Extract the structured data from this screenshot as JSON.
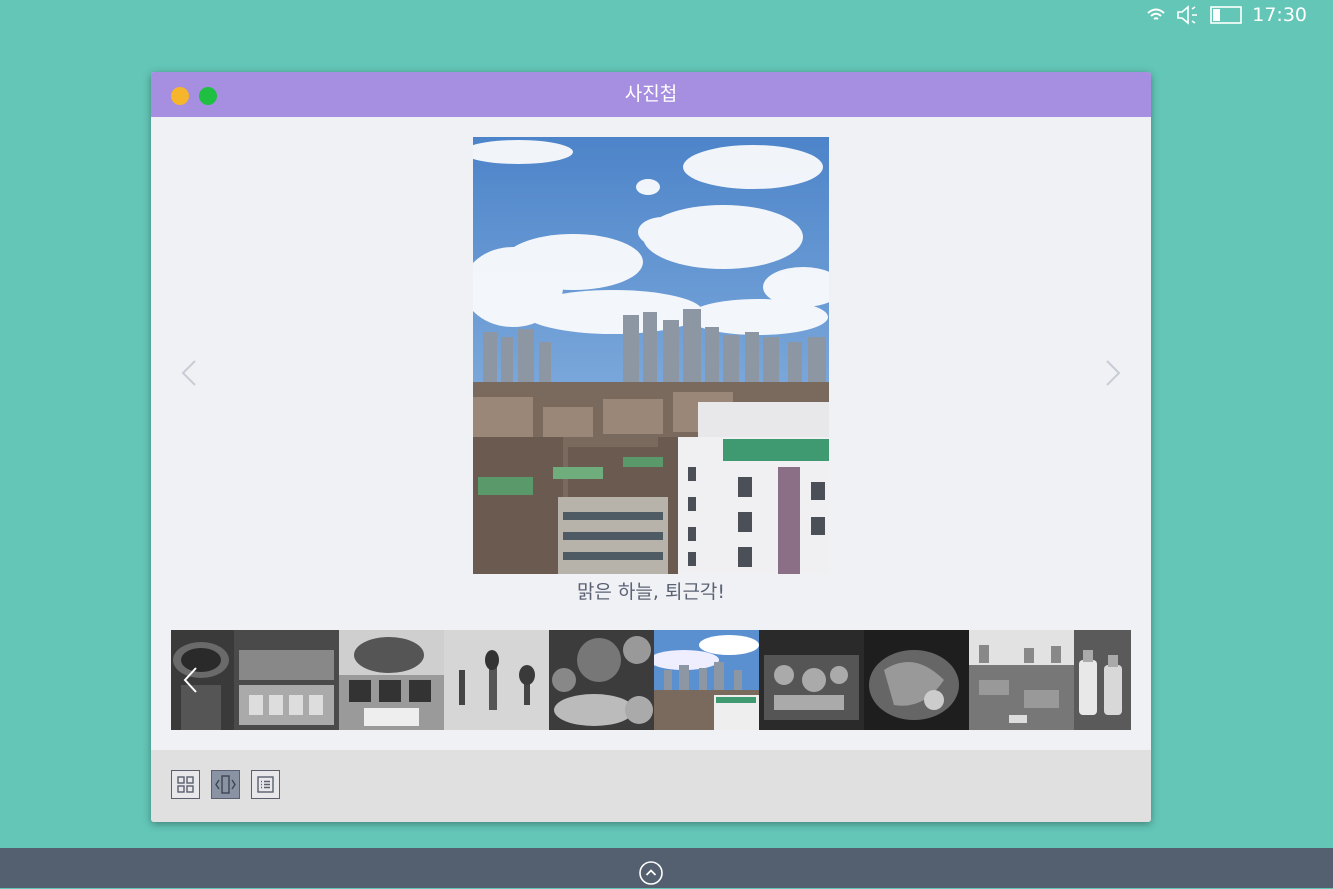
{
  "status": {
    "time": "17:30",
    "wifi_icon": "wifi-icon",
    "volume_icon": "volume-muted-icon",
    "battery_icon": "battery-low-icon"
  },
  "window": {
    "title": "사진첩"
  },
  "viewer": {
    "caption": "맑은 하늘, 퇴근각!",
    "prev_icon": "chevron-left-icon",
    "next_icon": "chevron-right-icon"
  },
  "thumbnails": [
    {
      "subject": "drink",
      "selected": false
    },
    {
      "subject": "sushi-platter",
      "selected": false
    },
    {
      "subject": "bonsai-and-cups",
      "selected": false
    },
    {
      "subject": "plants-on-wall",
      "selected": false
    },
    {
      "subject": "dishes-table",
      "selected": false
    },
    {
      "subject": "city-skyline",
      "selected": true
    },
    {
      "subject": "seafood-platter",
      "selected": false
    },
    {
      "subject": "lobster-dish",
      "selected": false
    },
    {
      "subject": "city-view",
      "selected": false
    },
    {
      "subject": "bottles",
      "selected": false
    }
  ],
  "view_modes": [
    {
      "name": "grid-view",
      "icon": "grid-icon",
      "active": false
    },
    {
      "name": "slide-view",
      "icon": "carousel-icon",
      "active": true
    },
    {
      "name": "list-view",
      "icon": "list-icon",
      "active": false
    }
  ],
  "colors": {
    "desktop": "#63c6b7",
    "titlebar": "#a68fe0",
    "taskbar": "#545f70",
    "minimize": "#f7b52b",
    "maximize": "#1fbf42"
  }
}
